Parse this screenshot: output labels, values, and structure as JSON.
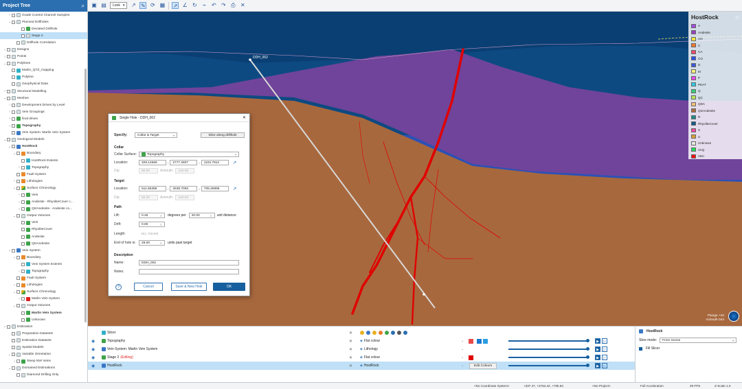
{
  "tree": {
    "title": "Project Tree",
    "items": [
      {
        "d": 1,
        "tw": ">",
        "icon": "folder",
        "label": "Grade Control Channel Samples"
      },
      {
        "d": 1,
        "tw": "v",
        "icon": "folder",
        "label": "Planned Drillholes"
      },
      {
        "d": 3,
        "tw": "",
        "icon": "green",
        "label": "Deviated Drillhole"
      },
      {
        "d": 3,
        "tw": "",
        "icon": "folder",
        "label": "Stage 2",
        "sel": true
      },
      {
        "d": 2,
        "tw": "",
        "icon": "folder",
        "label": "Drillhole Correlation"
      },
      {
        "d": 0,
        "tw": ">",
        "icon": "folder",
        "label": "Designs"
      },
      {
        "d": 0,
        "tw": ">",
        "icon": "folder",
        "label": "Points"
      },
      {
        "d": 0,
        "tw": "v",
        "icon": "folder",
        "label": "Polylines"
      },
      {
        "d": 1,
        "tw": "",
        "icon": "cyan",
        "label": "Marlin_QTZ_mapping"
      },
      {
        "d": 1,
        "tw": "",
        "icon": "cyan",
        "label": "Polyline"
      },
      {
        "d": 1,
        "tw": "",
        "icon": "folder",
        "label": "Geophysical Data"
      },
      {
        "d": 0,
        "tw": ">",
        "icon": "folder",
        "label": "Structural Modelling"
      },
      {
        "d": 0,
        "tw": "v",
        "icon": "folder",
        "label": "Meshes"
      },
      {
        "d": 1,
        "tw": ">",
        "icon": "folder",
        "label": "Development Drives by Level"
      },
      {
        "d": 1,
        "tw": ">",
        "icon": "folder",
        "label": "Vein Groupings"
      },
      {
        "d": 1,
        "tw": ">",
        "icon": "green",
        "label": "final drives"
      },
      {
        "d": 1,
        "tw": ">",
        "icon": "green",
        "label": "Topography",
        "bold": true
      },
      {
        "d": 1,
        "tw": "",
        "icon": "blue",
        "label": "Vein System: Marlin Vein System"
      },
      {
        "d": 0,
        "tw": "v",
        "icon": "folder",
        "label": "Geological Models"
      },
      {
        "d": 1,
        "tw": "v",
        "icon": "blue",
        "label": "HostRock",
        "bold": true
      },
      {
        "d": 2,
        "tw": "v",
        "icon": "orange",
        "label": "Boundary"
      },
      {
        "d": 3,
        "tw": "",
        "icon": "cyan",
        "label": "HostRock Extents"
      },
      {
        "d": 3,
        "tw": ">",
        "icon": "cyan",
        "label": "Topography"
      },
      {
        "d": 2,
        "tw": "",
        "icon": "orange",
        "label": "Fault System"
      },
      {
        "d": 2,
        "tw": ">",
        "icon": "orange",
        "label": "Lithologies"
      },
      {
        "d": 2,
        "tw": "v",
        "icon": "multi",
        "label": "Surface Chronology"
      },
      {
        "d": 3,
        "tw": ">",
        "icon": "green",
        "label": "Vein"
      },
      {
        "d": 3,
        "tw": ">",
        "icon": "green",
        "label": "Andesite - RhyoliteCover c..."
      },
      {
        "d": 3,
        "tw": ">",
        "icon": "green",
        "label": "QtzAndesite - Andesite co..."
      },
      {
        "d": 2,
        "tw": "v",
        "icon": "folder",
        "label": "Output Volumes"
      },
      {
        "d": 3,
        "tw": "",
        "icon": "green",
        "label": "Vein"
      },
      {
        "d": 3,
        "tw": "",
        "icon": "green",
        "label": "RhyoliteCover"
      },
      {
        "d": 3,
        "tw": "",
        "icon": "green",
        "label": "Andesite"
      },
      {
        "d": 3,
        "tw": "",
        "icon": "green",
        "label": "QtzAndesite"
      },
      {
        "d": 1,
        "tw": "v",
        "icon": "blue",
        "label": "Vein System"
      },
      {
        "d": 2,
        "tw": "v",
        "icon": "orange",
        "label": "Boundary"
      },
      {
        "d": 3,
        "tw": "",
        "icon": "cyan",
        "label": "Vein System Extents"
      },
      {
        "d": 3,
        "tw": ">",
        "icon": "cyan",
        "label": "Topography"
      },
      {
        "d": 2,
        "tw": "",
        "icon": "orange",
        "label": "Fault System"
      },
      {
        "d": 2,
        "tw": ">",
        "icon": "orange",
        "label": "Lithologies"
      },
      {
        "d": 2,
        "tw": "v",
        "icon": "multi",
        "label": "Surface Chronology"
      },
      {
        "d": 3,
        "tw": ">",
        "icon": "red",
        "label": "Marlin Vein System"
      },
      {
        "d": 2,
        "tw": "v",
        "icon": "folder",
        "label": "Output Volumes"
      },
      {
        "d": 3,
        "tw": "",
        "icon": "green",
        "label": "Marlin Vein System",
        "bold": true
      },
      {
        "d": 3,
        "tw": "",
        "icon": "green",
        "label": "Unknown"
      },
      {
        "d": 0,
        "tw": "v",
        "icon": "folder",
        "label": "Estimation"
      },
      {
        "d": 1,
        "tw": "",
        "icon": "folder",
        "label": "Preparation Datasets"
      },
      {
        "d": 1,
        "tw": "",
        "icon": "folder",
        "label": "Estimation Datasets"
      },
      {
        "d": 1,
        "tw": "",
        "icon": "folder",
        "label": "Spatial Models"
      },
      {
        "d": 1,
        "tw": "v",
        "icon": "folder",
        "label": "Variable Orientation"
      },
      {
        "d": 2,
        "tw": ">",
        "icon": "green",
        "label": "Steep NW Veins"
      },
      {
        "d": 1,
        "tw": "v",
        "icon": "folder",
        "label": "Domained Estimations"
      },
      {
        "d": 2,
        "tw": "",
        "icon": "folder",
        "label": "Diamond Drilling Only"
      }
    ]
  },
  "toolbar": {
    "look_label": "Look"
  },
  "scene": {
    "hole_label": "DDH_002",
    "plunge": "Plunge +10",
    "azimuth": "Azimuth 044"
  },
  "legend": {
    "title": "HostRock",
    "items": [
      {
        "label": "A",
        "color": "#a24ce0"
      },
      {
        "label": "Andesite",
        "color": "#9a3fc2"
      },
      {
        "label": "AO",
        "color": "#f2e640"
      },
      {
        "label": "C",
        "color": "#f07a2a"
      },
      {
        "label": "CA",
        "color": "#f04a6e"
      },
      {
        "label": "CO",
        "color": "#2f52e8"
      },
      {
        "label": "D",
        "color": "#3a5ad8"
      },
      {
        "label": "M",
        "color": "#f4f07a"
      },
      {
        "label": "P",
        "color": "#e84ae8"
      },
      {
        "label": "PEAT",
        "color": "#32c8e4"
      },
      {
        "label": "Q",
        "color": "#34d07a"
      },
      {
        "label": "QC",
        "color": "#b4e85a"
      },
      {
        "label": "QDA",
        "color": "#f4c07a"
      },
      {
        "label": "QtzAndesite",
        "color": "#b07040"
      },
      {
        "label": "R",
        "color": "#1e8a8a"
      },
      {
        "label": "RhyoliteCover",
        "color": "#145a8a"
      },
      {
        "label": "S",
        "color": "#f04aa0"
      },
      {
        "label": "U",
        "color": "#d8a038"
      },
      {
        "label": "Unknown",
        "color": "#e8e8e8"
      },
      {
        "label": "VAQ",
        "color": "#22e05a"
      },
      {
        "label": "Vein",
        "color": "#ee1111"
      }
    ]
  },
  "dialog": {
    "title": "Single Hole - DDH_002",
    "specify_label": "Specify:",
    "specify_value": "Collar & Target",
    "slice_btn": "Slice along drillhole",
    "collar_section": "Collar",
    "collar_surface_label": "Collar Surface:",
    "collar_surface_value": "Topography",
    "location_label": "Location:",
    "collar_x": "329.14569",
    "collar_y": "2777.2807",
    "collar_z": "1104.7812",
    "dip_label": "Dip:",
    "collar_dip": "60.00",
    "azimuth_label": "Azimuth:",
    "collar_azimuth": "140.00",
    "target_section": "Target",
    "target_x": "511.55369",
    "target_y": "2538.7093",
    "target_z": "705.25995",
    "target_dip": "60.00",
    "target_azimuth": "140.00",
    "path_section": "Path",
    "lift_label": "Lift:",
    "lift_value": "0.45",
    "degrees_per": "degrees per",
    "per_value": "20.00",
    "unit_distance": "unit distance",
    "drift_label": "Drift:",
    "drift_value": "0.00",
    "length_label": "Length:",
    "length_value": "461.726499",
    "end_label": "End of hole is:",
    "end_value": "29.00",
    "units_past": "units past target",
    "desc_section": "Description",
    "name_label": "Name:",
    "name_value": "DDH_002",
    "notes_label": "Notes:",
    "help": "?",
    "cancel": "Cancel",
    "save_new": "Save & New Hole",
    "ok": "OK"
  },
  "layers": [
    {
      "name": "Slicer",
      "icon": "slicer",
      "col": "",
      "sel": false
    },
    {
      "name": "Topography",
      "icon": "green",
      "col": "Flat colour",
      "sel": false
    },
    {
      "name": "Vein System: Marlin Vein System",
      "icon": "blue",
      "col": "Lithology",
      "sel": false
    },
    {
      "name": "Stage 2",
      "editing": "(Editing)",
      "icon": "green",
      "col": "Flat colour",
      "sel": false
    },
    {
      "name": "HostRock",
      "icon": "blue",
      "col": "HostRock",
      "sel": true
    }
  ],
  "edit_colours": "Edit Colours",
  "props": {
    "title": "HostRock",
    "slice_mode_label": "Slice mode:",
    "slice_mode_value": "From Scene",
    "fill_slicer": "Fill Slicer"
  },
  "status": {
    "coord_sys": "<No Coordinate System>",
    "cursor": "+337.47, +2764.42, +785.63",
    "project": "<No Project>",
    "accel": "Full Acceleration",
    "fps": "29 FPS",
    "zscale": "Z-Scale 1.0"
  }
}
